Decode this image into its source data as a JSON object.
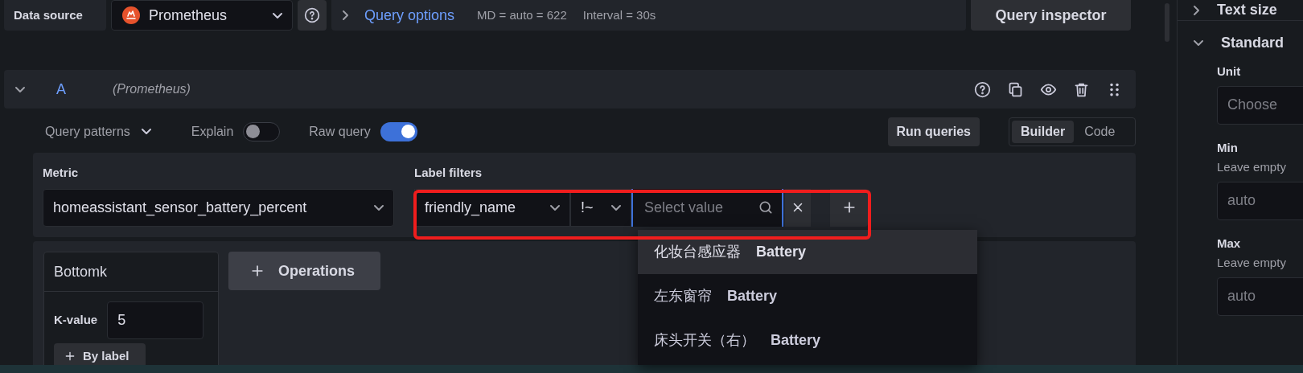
{
  "toolbar": {
    "data_source_label": "Data source",
    "datasource": "Prometheus",
    "query_options": {
      "expanded": false,
      "label": "Query options",
      "max_data_points": "MD = auto = 622",
      "interval": "Interval = 30s"
    },
    "query_inspector": "Query inspector"
  },
  "query": {
    "expanded": true,
    "ref_id": "A",
    "datasource": "(Prometheus)"
  },
  "options_row": {
    "query_patterns": "Query patterns",
    "toggles": [
      {
        "label": "Explain",
        "on": false
      },
      {
        "label": "Raw query",
        "on": true
      }
    ],
    "run_queries": "Run queries",
    "modes": [
      {
        "label": "Builder",
        "selected": true
      },
      {
        "label": "Code",
        "selected": false
      }
    ]
  },
  "metric": {
    "label": "Metric",
    "value": "homeassistant_sensor_battery_percent"
  },
  "label_filters": {
    "label": "Label filters",
    "filters": [
      {
        "label": "friendly_name",
        "operator": "!~",
        "placeholder": "Select value"
      }
    ]
  },
  "dropdown": {
    "options": [
      {
        "text": "化妆台感应器 **Battery**",
        "selected": true
      },
      {
        "text": "左东窗帘 **Battery**",
        "selected": false
      },
      {
        "text": "床头开关（右） **Battery**",
        "selected": false
      }
    ]
  },
  "operations": {
    "cards": [
      {
        "title": "Bottomk",
        "param_label": "K-value",
        "param_value": "5",
        "add_button": "By label"
      }
    ],
    "add_button": "Operations"
  },
  "side_panel": {
    "sections": [
      {
        "title": "Text size",
        "expanded": false
      },
      {
        "title": "Standard",
        "expanded": true
      }
    ],
    "fields": [
      {
        "label": "Unit",
        "placeholder": "Choose"
      },
      {
        "label": "Min",
        "description": "Leave empty",
        "placeholder": "auto"
      },
      {
        "label": "Max",
        "description": "Leave empty",
        "placeholder": "auto"
      }
    ]
  }
}
